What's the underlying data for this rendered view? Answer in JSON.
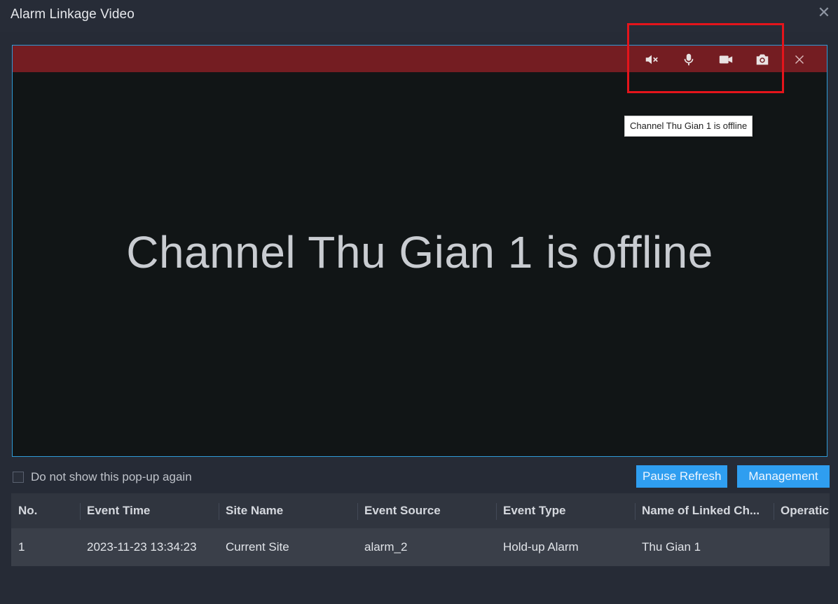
{
  "window": {
    "title": "Alarm Linkage Video",
    "close_icon": "close-icon"
  },
  "video": {
    "toolbar_icons": [
      "mute-icon",
      "microphone-icon",
      "record-icon",
      "snapshot-icon",
      "close-icon"
    ],
    "offline_message": "Channel Thu Gian 1 is offline",
    "tooltip": "Channel Thu Gian 1 is offline",
    "toolbar_color": "#741d22",
    "highlight_color": "#e4141b"
  },
  "footer": {
    "checkbox_label": "Do not show this pop-up again",
    "pause_refresh_label": "Pause Refresh",
    "management_label": "Management"
  },
  "table": {
    "columns": [
      "No.",
      "Event Time",
      "Site Name",
      "Event Source",
      "Event Type",
      "Name of Linked Ch...",
      "Operatic"
    ],
    "rows": [
      [
        "1",
        "2023-11-23 13:34:23",
        "Current Site",
        "alarm_2",
        "Hold-up Alarm",
        "Thu Gian 1",
        ""
      ]
    ]
  }
}
